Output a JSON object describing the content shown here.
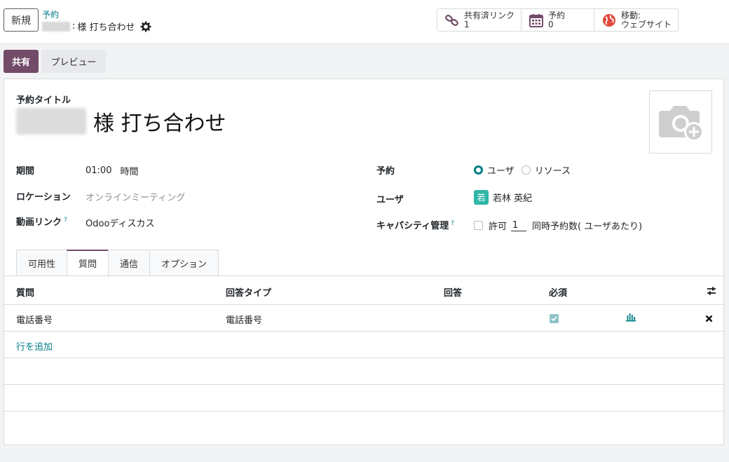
{
  "control": {
    "new_label": "新規",
    "breadcrumb_parent": "予約",
    "breadcrumb_current_prefix": ":",
    "breadcrumb_current": "様 打ち合わせ",
    "smart_buttons": [
      {
        "label": "共有済リンク",
        "value": "1",
        "icon": "link-icon"
      },
      {
        "label": "予約",
        "value": "0",
        "icon": "calendar-icon"
      },
      {
        "label": "移動:",
        "value": "ウェブサイト",
        "icon": "globe-icon"
      }
    ]
  },
  "actions": {
    "share_label": "共有",
    "preview_label": "プレビュー"
  },
  "form": {
    "title_label": "予約タイトル",
    "title_value": "様 打ち合わせ",
    "duration_label": "期間",
    "duration_value": "01:00",
    "duration_unit": "時間",
    "location_label": "ロケーション",
    "location_placeholder": "オンラインミーティング",
    "video_label": "動画リンク",
    "video_value": "Odooディスカス",
    "help_mark": "?",
    "booking_label": "予約",
    "booking_option_user": "ユーザ",
    "booking_option_resource": "リソース",
    "booking_selected": "ユーザ",
    "users_label": "ユーザ",
    "user_initial": "若",
    "user_name": "若林 英紀",
    "capacity_label": "キャパシティ管理",
    "capacity_allow": "許可",
    "capacity_number": "1",
    "capacity_suffix": "同時予約数( ユーザあたり)"
  },
  "tabs": [
    {
      "label": "可用性",
      "active": false
    },
    {
      "label": "質問",
      "active": true
    },
    {
      "label": "通信",
      "active": false
    },
    {
      "label": "オプション",
      "active": false
    }
  ],
  "table": {
    "headers": [
      "質問",
      "回答タイプ",
      "回答",
      "必須"
    ],
    "rows": [
      {
        "question": "電話番号",
        "answer_type": "電話番号",
        "answer": "",
        "required": true
      }
    ],
    "add_line": "行を追加"
  },
  "colors": {
    "primary": "#714b67",
    "accent": "#017e84",
    "avatar": "#2fb6a8"
  }
}
